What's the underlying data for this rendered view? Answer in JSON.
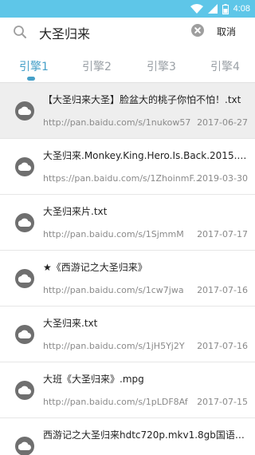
{
  "status_bar": {
    "time": "4:08",
    "background": "#5ec6e8"
  },
  "search": {
    "query": "大圣归来",
    "cancel_label": "取消"
  },
  "tabs": [
    {
      "label": "引擎1",
      "active": true
    },
    {
      "label": "引擎2",
      "active": false
    },
    {
      "label": "引擎3",
      "active": false
    },
    {
      "label": "引擎4",
      "active": false
    }
  ],
  "accent_color": "#46a0c8",
  "results": [
    {
      "title": "【大圣归来大圣】脸盆大的桃子你怕不怕！.txt",
      "url": "http://pan.baidu.com/s/1nukow57",
      "date": "2017-06-27",
      "highlighted": true
    },
    {
      "title": "大圣归来.Monkey.King.Hero.Is.Back.2015.720...",
      "url": "https://pan.baidu.com/s/1ZhoinmF...",
      "date": "2019-03-30",
      "highlighted": false
    },
    {
      "title": "大圣归来片.txt",
      "url": "http://pan.baidu.com/s/1SjmmM",
      "date": "2017-07-17",
      "highlighted": false
    },
    {
      "title": "★《西游记之大圣归来》",
      "url": "http://pan.baidu.com/s/1cw7jwa",
      "date": "2017-07-16",
      "highlighted": false
    },
    {
      "title": "大圣归来.txt",
      "url": "http://pan.baidu.com/s/1jH5Yj2Y",
      "date": "2017-07-16",
      "highlighted": false
    },
    {
      "title": "大班《大圣归来》.mpg",
      "url": "http://pan.baidu.com/s/1pLDF8Af",
      "date": "2017-07-15",
      "highlighted": false
    },
    {
      "title": "西游记之大圣归来hdtc720p.mkv1.8gb国语中...",
      "url": "",
      "date": "",
      "highlighted": false
    }
  ]
}
